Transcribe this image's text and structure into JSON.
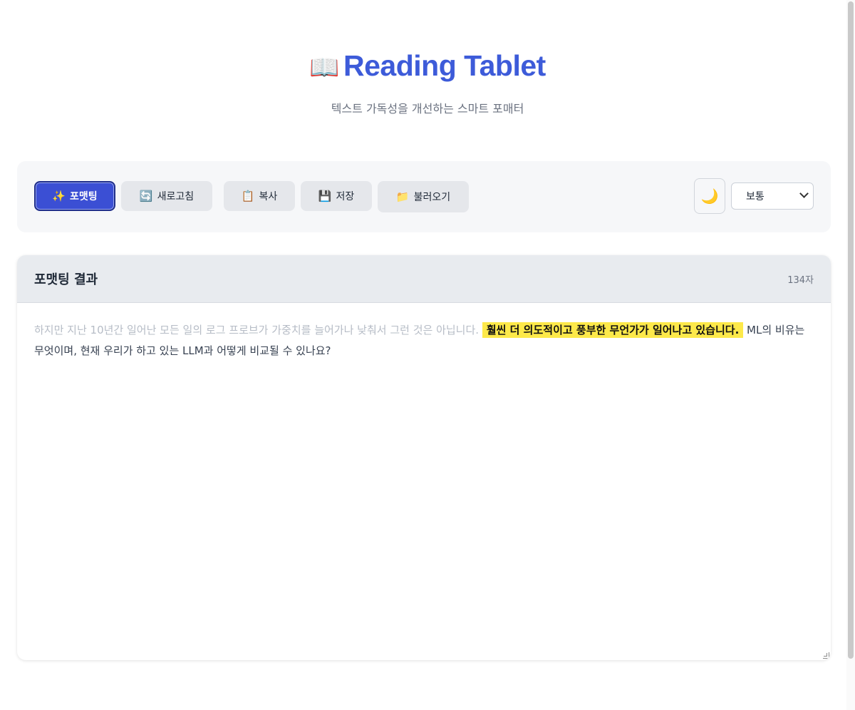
{
  "header": {
    "icon": "open-book-icon",
    "title": "Reading Tablet",
    "subtitle": "텍스트 가독성을 개선하는 스마트 포매터"
  },
  "toolbar": {
    "buttons": [
      {
        "icon": "sparkles-icon",
        "glyph": "✨",
        "label": "포맷팅",
        "active": true
      },
      {
        "icon": "refresh-icon",
        "glyph": "🔄",
        "label": "새로고침"
      },
      {
        "icon": "clipboard-icon",
        "glyph": "📋",
        "label": "복사"
      },
      {
        "icon": "floppy-disk-icon",
        "glyph": "💾",
        "label": "저장"
      },
      {
        "icon": "folder-icon",
        "glyph": "📁",
        "label": "불러오기"
      }
    ],
    "theme_toggle": {
      "icon": "moon-icon",
      "glyph": "🌙"
    },
    "size_select": {
      "value": "보통"
    }
  },
  "result": {
    "title": "포맷팅 결과",
    "char_count": "134자",
    "faded_text": "하지만 지난 10년간 일어난 모든 일의 로그 프로브가 가중치를 늘어가나 낮춰서 그런 것은 아닙니다.",
    "highlight_text": "훨씬 더 의도적이고 풍부한 무언가가 일어나고 있습니다.",
    "normal_text": "ML의 비유는 무엇이며, 현재 우리가 하고 있는 LLM과 어떻게 비교될 수 있나요?"
  },
  "colors": {
    "accent": "#3d5bd9",
    "primary_button": "#3b4fd4",
    "highlight": "#fde94a"
  }
}
